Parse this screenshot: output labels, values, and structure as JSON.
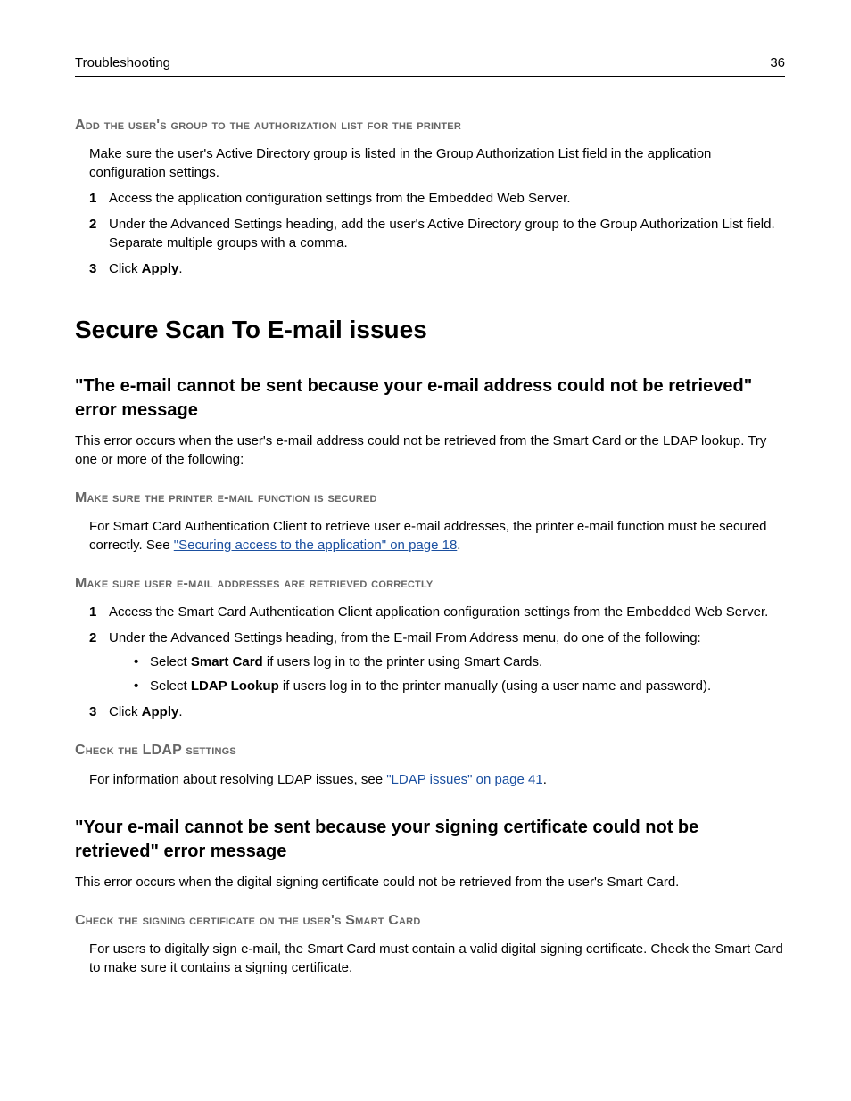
{
  "header": {
    "left": "Troubleshooting",
    "right": "36"
  },
  "sec1": {
    "title": "Add the user's group to the authorization list for the printer",
    "intro": "Make sure the user's Active Directory group is listed in the Group Authorization List field in the application configuration settings.",
    "step1": "Access the application configuration settings from the Embedded Web Server.",
    "step2": "Under the Advanced Settings heading, add the user's Active Directory group to the Group Authorization List field. Separate multiple groups with a comma.",
    "step3_pre": "Click ",
    "step3_bold": "Apply",
    "step3_post": "."
  },
  "h1": "Secure Scan To E-mail issues",
  "sec2": {
    "title": "\"The e-mail cannot be sent because your e-mail address could not be retrieved\" error message",
    "intro": "This error occurs when the user's e-mail address could not be retrieved from the Smart Card or the LDAP lookup. Try one or more of the following:"
  },
  "sec3": {
    "title": "Make sure the printer e-mail function is secured",
    "p_pre": "For Smart Card Authentication Client to retrieve user e-mail addresses, the printer e-mail function must be secured correctly. See ",
    "link": "\"Securing access to the application\" on page 18",
    "p_post": "."
  },
  "sec4": {
    "title": "Make sure user e-mail addresses are retrieved correctly",
    "step1": "Access the Smart Card Authentication Client application configuration settings from the Embedded Web Server.",
    "step2": "Under the Advanced Settings heading, from the E-mail From Address menu, do one of the following:",
    "b1_pre": "Select ",
    "b1_bold": "Smart Card",
    "b1_post": " if users log in to the printer using Smart Cards.",
    "b2_pre": "Select ",
    "b2_bold": "LDAP Lookup",
    "b2_post": " if users log in to the printer manually (using a user name and password).",
    "step3_pre": "Click ",
    "step3_bold": "Apply",
    "step3_post": "."
  },
  "sec5": {
    "title": "Check the LDAP settings",
    "p_pre": "For information about resolving LDAP issues, see ",
    "link": "\"LDAP issues\" on page 41",
    "p_post": "."
  },
  "sec6": {
    "title": "\"Your e-mail cannot be sent because your signing certificate could not be retrieved\" error message",
    "intro": "This error occurs when the digital signing certificate could not be retrieved from the user's Smart Card."
  },
  "sec7": {
    "title": "Check the signing certificate on the user's Smart Card",
    "p": "For users to digitally sign e-mail, the Smart Card must contain a valid digital signing certificate. Check the Smart Card to make sure it contains a signing certificate."
  },
  "nums": {
    "n1": "1",
    "n2": "2",
    "n3": "3"
  }
}
